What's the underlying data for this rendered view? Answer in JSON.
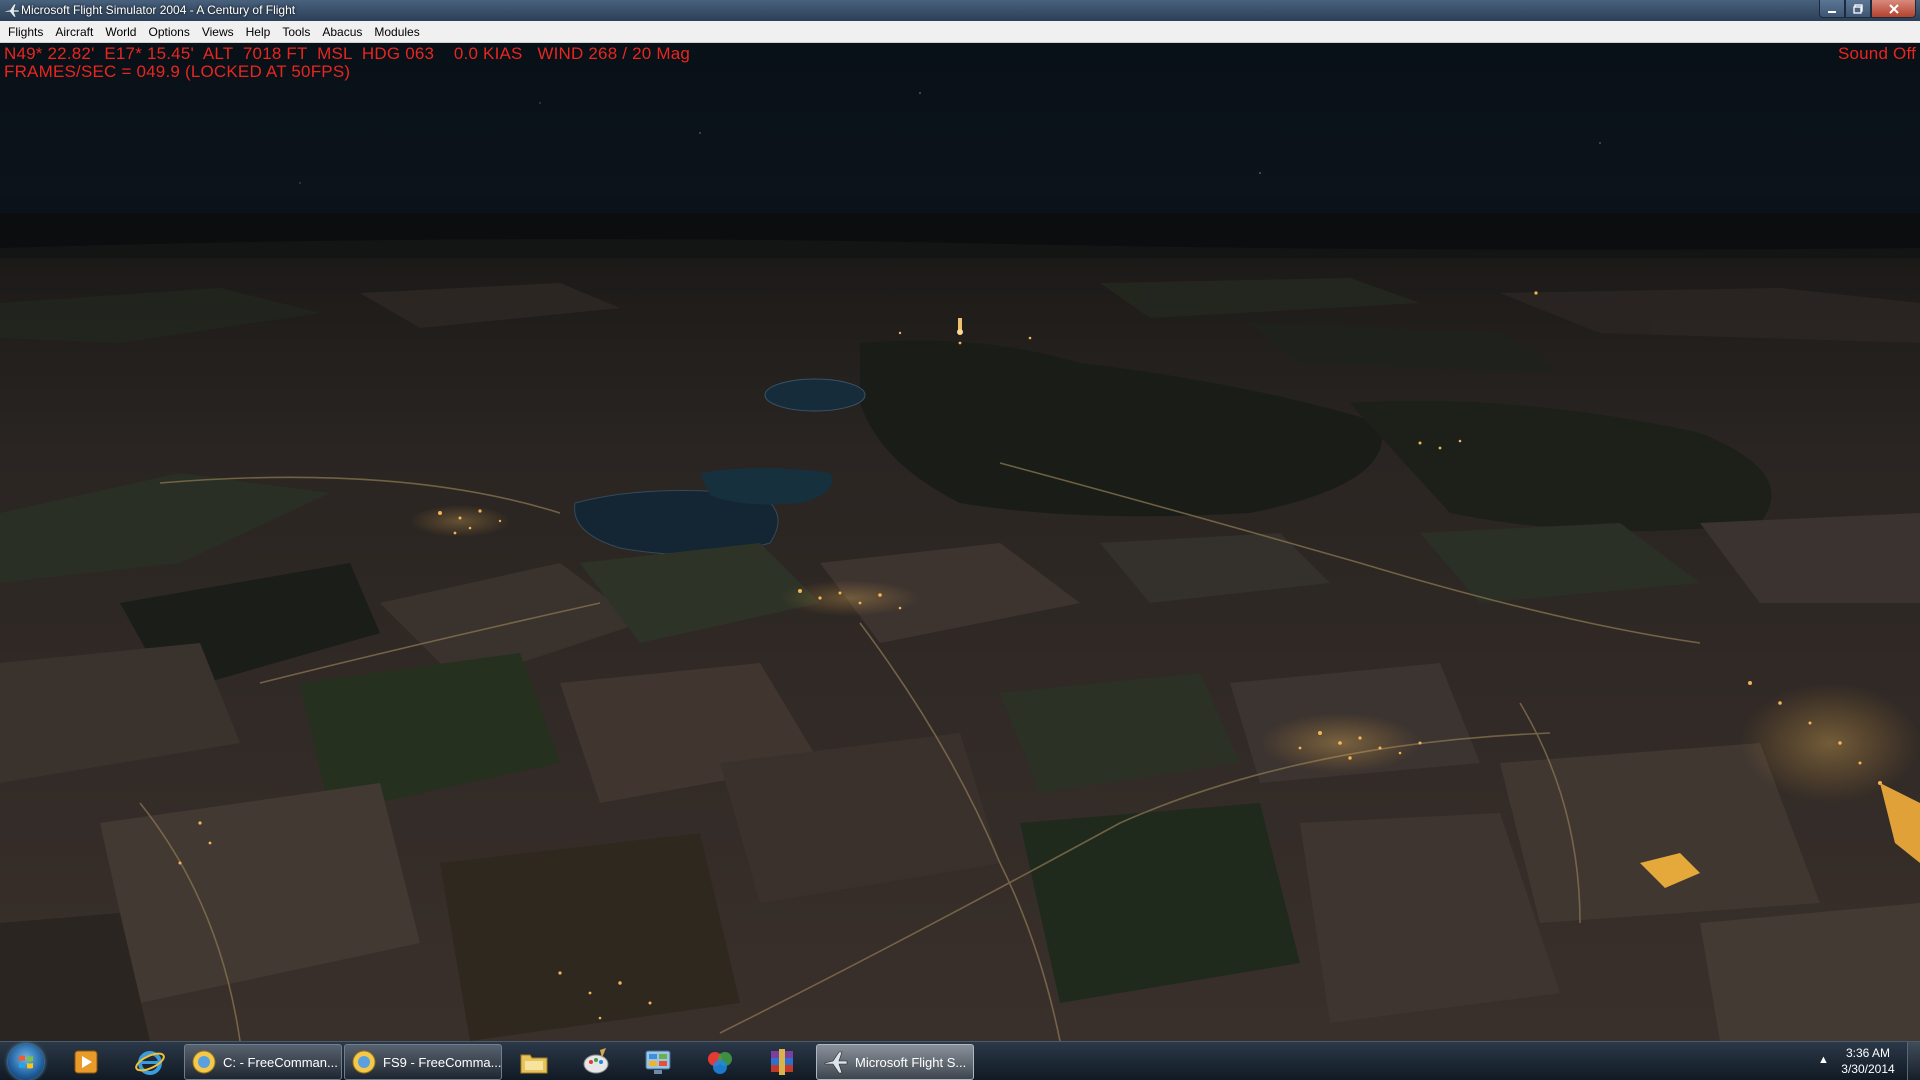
{
  "window": {
    "title": "Microsoft Flight Simulator 2004 - A Century of Flight",
    "icons": {
      "app": "airplane-icon",
      "minimize": "minimize-icon",
      "maximize": "maximize-icon",
      "close": "close-icon"
    }
  },
  "menu": {
    "items": [
      {
        "label": "Flights"
      },
      {
        "label": "Aircraft"
      },
      {
        "label": "World"
      },
      {
        "label": "Options"
      },
      {
        "label": "Views"
      },
      {
        "label": "Help"
      },
      {
        "label": "Tools"
      },
      {
        "label": "Abacus"
      },
      {
        "label": "Modules"
      }
    ]
  },
  "hud": {
    "line1": "N49* 22.82'  E17* 15.45'  ALT  7018 FT  MSL  HDG 063    0.0 KIAS   WIND 268 / 20 Mag",
    "line2": "FRAMES/SEC = 049.9 (LOCKED AT 50FPS)",
    "sound": "Sound Off",
    "color": "#e8261f"
  },
  "taskbar": {
    "start_icon": "windows-start-icon",
    "quick_launch": [
      {
        "icon": "media-player-icon"
      },
      {
        "icon": "internet-explorer-icon"
      }
    ],
    "tasks": [
      {
        "label": "C: - FreeComman...",
        "icon": "freecommander-icon",
        "active": false
      },
      {
        "label": "FS9 - FreeComma...",
        "icon": "freecommander-icon",
        "active": false
      }
    ],
    "pinned": [
      {
        "icon": "file-explorer-icon"
      },
      {
        "icon": "paint-icon"
      },
      {
        "icon": "control-panel-icon"
      },
      {
        "icon": "colorful-app-icon"
      },
      {
        "icon": "winrar-icon"
      }
    ],
    "active_task": {
      "label": "Microsoft Flight S...",
      "icon": "airplane-icon",
      "active": true
    },
    "tray": {
      "arrow": "▲",
      "time": "3:36 AM",
      "date": "3/30/2014"
    }
  }
}
